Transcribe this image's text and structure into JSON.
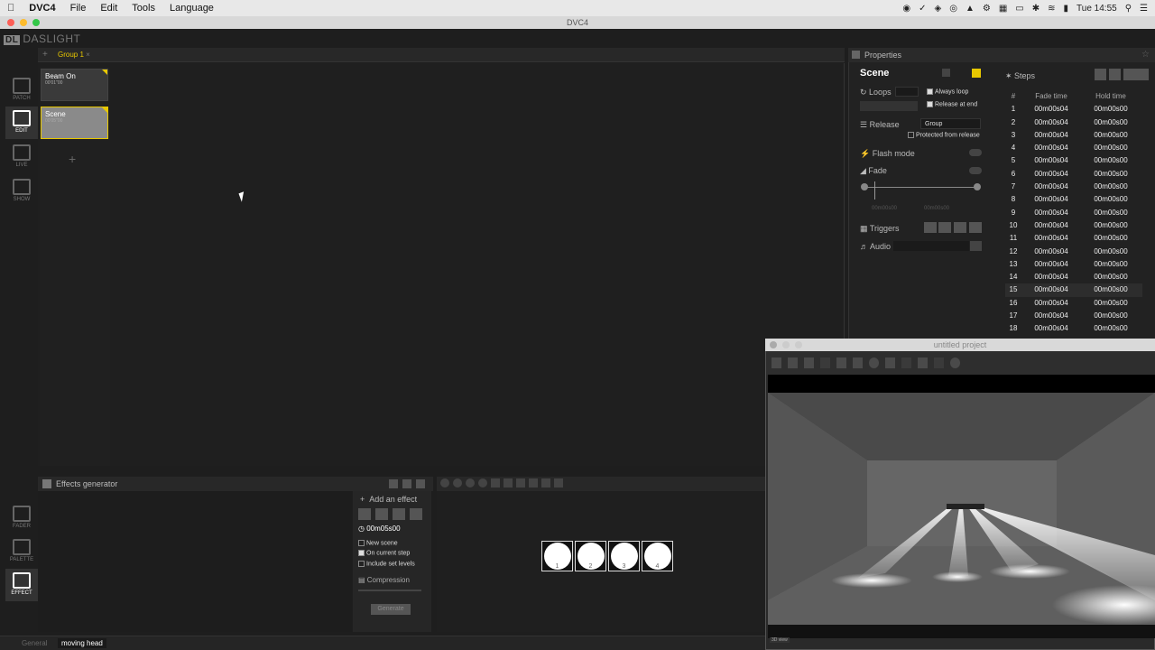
{
  "menubar": {
    "app": "DVC4",
    "items": [
      "File",
      "Edit",
      "Tools",
      "Language"
    ],
    "clock": "Tue 14:55"
  },
  "window": {
    "title": "DVC4"
  },
  "brand": {
    "name": "DASLIGHT"
  },
  "modes": [
    {
      "label": "PATCH"
    },
    {
      "label": "EDIT"
    },
    {
      "label": "LIVE"
    },
    {
      "label": "SHOW"
    }
  ],
  "bottom_modes": [
    {
      "label": "FADER"
    },
    {
      "label": "PALETTE"
    },
    {
      "label": "EFFECT"
    }
  ],
  "tabs": {
    "group": "Group 1"
  },
  "scenes": [
    {
      "name": "Beam On",
      "time": "00'01\"00"
    },
    {
      "name": "Scene",
      "time": "00'05\"00"
    }
  ],
  "properties": {
    "header": "Properties",
    "title": "Scene",
    "loops": "Loops",
    "always_loop": "Always loop",
    "release_at_end": "Release at end",
    "release": "Release",
    "release_value": "Group",
    "protected": "Protected from release",
    "flash_mode": "Flash mode",
    "fade": "Fade",
    "fade_start": "00m00s00",
    "fade_end": "00m00s00",
    "triggers": "Triggers",
    "audio": "Audio"
  },
  "steps": {
    "title": "Steps",
    "headers": [
      "#",
      "Fade time",
      "Hold time"
    ],
    "rows": [
      [
        "1",
        "00m00s04",
        "00m00s00"
      ],
      [
        "2",
        "00m00s04",
        "00m00s00"
      ],
      [
        "3",
        "00m00s04",
        "00m00s00"
      ],
      [
        "4",
        "00m00s04",
        "00m00s00"
      ],
      [
        "5",
        "00m00s04",
        "00m00s00"
      ],
      [
        "6",
        "00m00s04",
        "00m00s00"
      ],
      [
        "7",
        "00m00s04",
        "00m00s00"
      ],
      [
        "8",
        "00m00s04",
        "00m00s00"
      ],
      [
        "9",
        "00m00s04",
        "00m00s00"
      ],
      [
        "10",
        "00m00s04",
        "00m00s00"
      ],
      [
        "11",
        "00m00s04",
        "00m00s00"
      ],
      [
        "12",
        "00m00s04",
        "00m00s00"
      ],
      [
        "13",
        "00m00s04",
        "00m00s00"
      ],
      [
        "14",
        "00m00s04",
        "00m00s00"
      ],
      [
        "15",
        "00m00s04",
        "00m00s00"
      ],
      [
        "16",
        "00m00s04",
        "00m00s00"
      ],
      [
        "17",
        "00m00s04",
        "00m00s00"
      ],
      [
        "18",
        "00m00s04",
        "00m00s00"
      ]
    ]
  },
  "effects": {
    "title": "Effects generator",
    "add": "Add an effect",
    "duration": "00m05s00",
    "new_scene": "New scene",
    "on_current_step": "On current step",
    "include_set_levels": "Include set levels",
    "compression": "Compression",
    "generate": "Generate"
  },
  "fixtures": [
    "1",
    "2",
    "3",
    "4"
  ],
  "bottom_tabs": [
    "General",
    "moving head"
  ],
  "viewer": {
    "title": "untitled project",
    "view_label": "3D view"
  }
}
